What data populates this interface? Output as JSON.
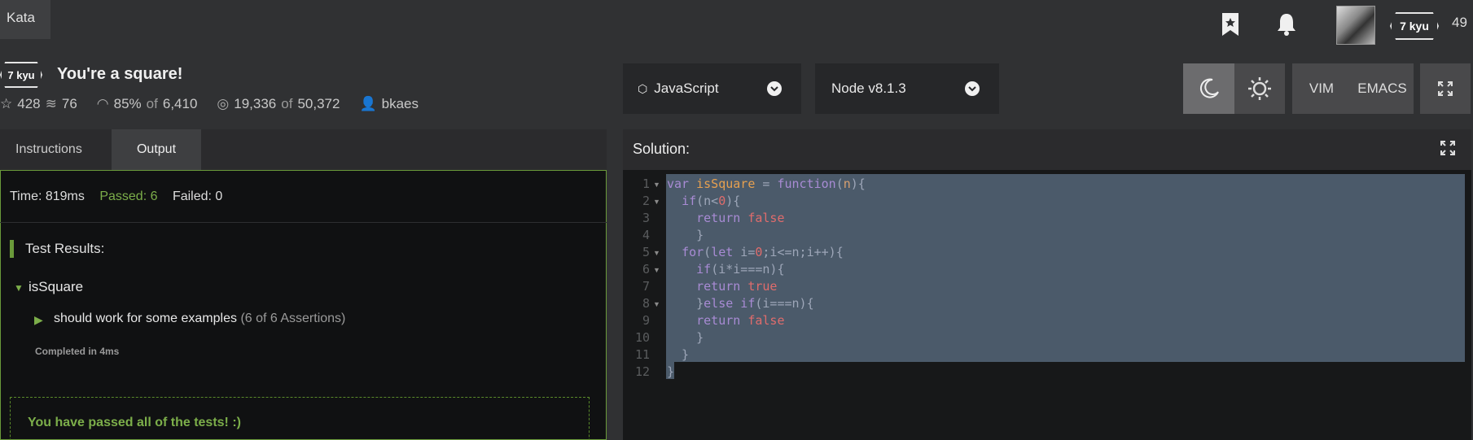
{
  "topbar": {
    "kata_label": "Kata",
    "rank": "7 kyu",
    "honor": "49"
  },
  "kata": {
    "rank": "7 kyu",
    "title": "You're a square!",
    "stars": "428",
    "collections": "76",
    "satisfaction": "85%",
    "satisfaction_of": "of",
    "votes": "6,410",
    "completed": "19,336",
    "completed_of": "of",
    "attempts": "50,372",
    "author": "bkaes"
  },
  "toolbar": {
    "language": "JavaScript",
    "version": "Node v8.1.3",
    "vim_label": "VIM",
    "emacs_label": "EMACS"
  },
  "tabs": {
    "instructions": "Instructions",
    "output": "Output"
  },
  "output": {
    "time": "Time: 819ms",
    "passed": "Passed: 6",
    "failed": "Failed: 0",
    "test_results": "Test Results:",
    "describe": "isSquare",
    "it": "should work for some examples",
    "assertions": "(6 of 6 Assertions)",
    "completed_in": "Completed in 4ms",
    "pass_message": "You have passed all of the tests! :)"
  },
  "solution": {
    "label": "Solution:",
    "line_numbers": [
      "1",
      "2",
      "3",
      "4",
      "5",
      "6",
      "7",
      "8",
      "9",
      "10",
      "11",
      "12"
    ]
  },
  "colors": {
    "accent_green": "#7cae4a",
    "selection": "#4b5a6a",
    "keyword": "#a88bd4",
    "number": "#e06c6c"
  },
  "icons": [
    "bookmark-icon",
    "bell-icon",
    "language-icon",
    "chevron-down-icon",
    "moon-icon",
    "sun-icon",
    "fullscreen-icon",
    "star-icon",
    "collections-icon",
    "eye-icon",
    "target-icon",
    "user-icon"
  ]
}
